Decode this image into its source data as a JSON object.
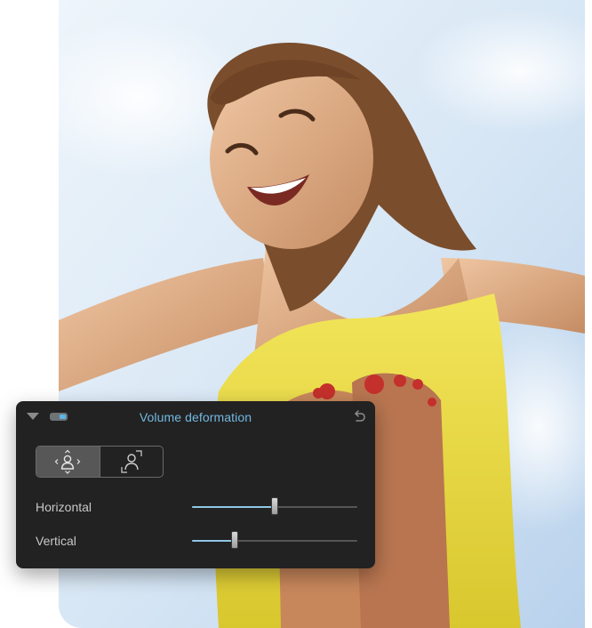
{
  "panel": {
    "title": "Volume deformation",
    "modes": [
      {
        "icon": "person-volume-icon",
        "active": true
      },
      {
        "icon": "person-frame-icon",
        "active": false
      }
    ],
    "sliders": [
      {
        "label": "Horizontal",
        "value": 0.5
      },
      {
        "label": "Vertical",
        "value": 0.26
      }
    ]
  },
  "colors": {
    "accent": "#72b8e2",
    "panel_bg": "#222222",
    "slider_fill": "#8fc7e8"
  }
}
